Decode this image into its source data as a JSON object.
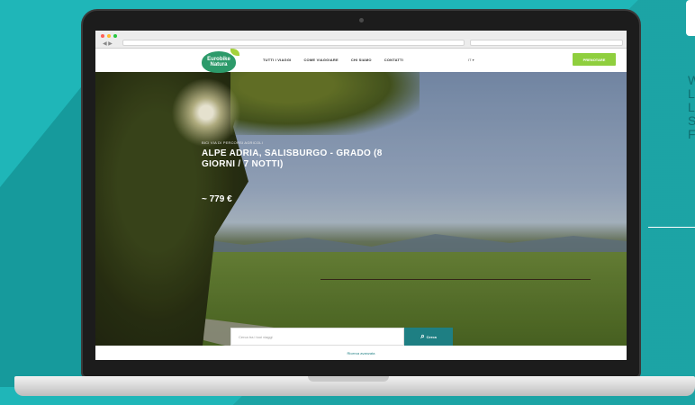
{
  "site": {
    "logo": {
      "line1": "Eurobike",
      "line2": "Natura"
    },
    "nav": [
      {
        "label": "TUTTI I VIAGGI"
      },
      {
        "label": "COME VIAGGIARE"
      },
      {
        "label": "CHI SIAMO"
      },
      {
        "label": "CONTATTI"
      }
    ],
    "language": "IT ▾",
    "cta_label": "PRENOTARE",
    "hero": {
      "kicker": "BICI VIA DI PERCORSI AGRICOLI",
      "title": "ALPE ADRIA, SALISBURGO - GRADO (8 GIORNI / 7 NOTTI)",
      "price": "~ 779 €"
    },
    "search": {
      "placeholder": "Cerca tra i tuoi viaggi",
      "button_label": "Cerca"
    },
    "footer_link": "Ricerca avanzata"
  },
  "side_letters": [
    "W",
    "L",
    "L",
    "S",
    "F"
  ],
  "colors": {
    "background": "#1fb6b8",
    "accent_teal": "#1e7f83",
    "accent_green": "#8fcf3e",
    "logo_green": "#2c9a6a"
  }
}
